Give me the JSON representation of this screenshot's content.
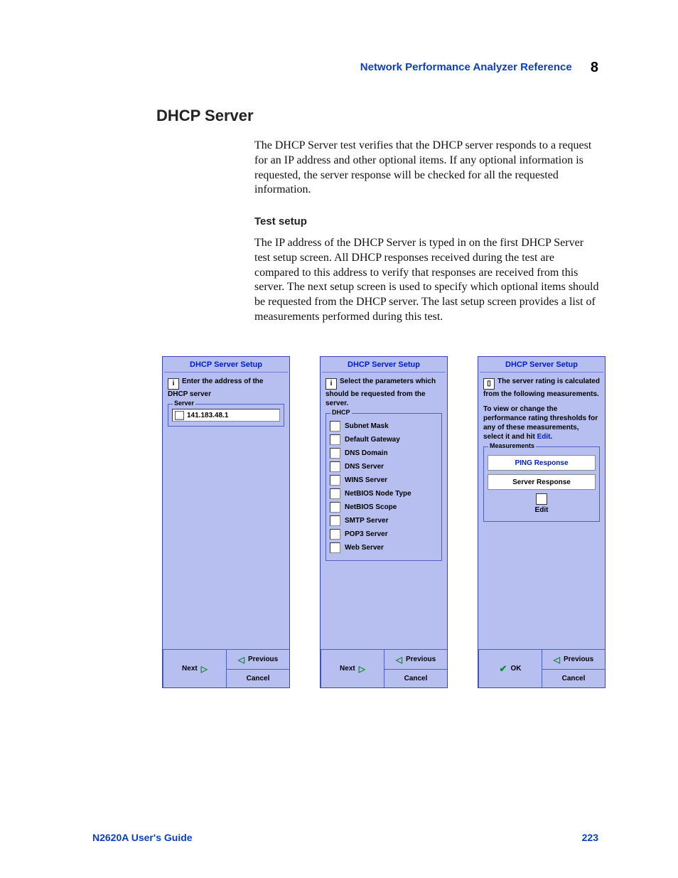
{
  "header": {
    "title": "Network Performance Analyzer Reference",
    "chapter": "8"
  },
  "section": {
    "heading": "DHCP Server"
  },
  "paragraphs": {
    "intro": "The DHCP Server test verifies that the DHCP server responds to a request for an IP address and other optional items. If any optional information is requested, the server response will be checked for all the requested information.",
    "test_setup_heading": "Test setup",
    "test_setup_body": "The IP address of the DHCP Server is typed in on the first DHCP Server test setup screen. All DHCP responses received during the test are compared to this address to verify that responses are received from this server. The next setup screen is used to specify which optional items should be requested from the DHCP server. The last setup screen provides a list of measurements performed during this test."
  },
  "panels": {
    "a": {
      "title": "DHCP Server Setup",
      "instruction": "Enter the address of the DHCP server",
      "group_label": "Server",
      "ip": "141.183.48.1",
      "buttons": {
        "prev": "Previous",
        "next": "Next",
        "cancel": "Cancel"
      }
    },
    "b": {
      "title": "DHCP Server Setup",
      "instruction": "Select the parameters which should be requested from the server.",
      "group_label": "DHCP",
      "options": [
        "Subnet Mask",
        "Default Gateway",
        "DNS Domain",
        "DNS Server",
        "WINS Server",
        "NetBIOS Node Type",
        "NetBIOS Scope",
        "SMTP Server",
        "POP3 Server",
        "Web Server"
      ],
      "buttons": {
        "prev": "Previous",
        "next": "Next",
        "cancel": "Cancel"
      }
    },
    "c": {
      "title": "DHCP Server Setup",
      "instruction": "The server rating is calculated from the following measurements.",
      "threshold_note_pre": "To view or change the performance rating thresholds for any of these measurements, select it and hit ",
      "threshold_note_edit": "Edit",
      "threshold_note_post": ".",
      "group_label": "Measurements",
      "measurements": [
        "PING Response",
        "Server Response"
      ],
      "edit_label": "Edit",
      "buttons": {
        "prev": "Previous",
        "ok": "OK",
        "cancel": "Cancel"
      }
    }
  },
  "footer": {
    "left": "N2620A User's Guide",
    "page": "223"
  }
}
